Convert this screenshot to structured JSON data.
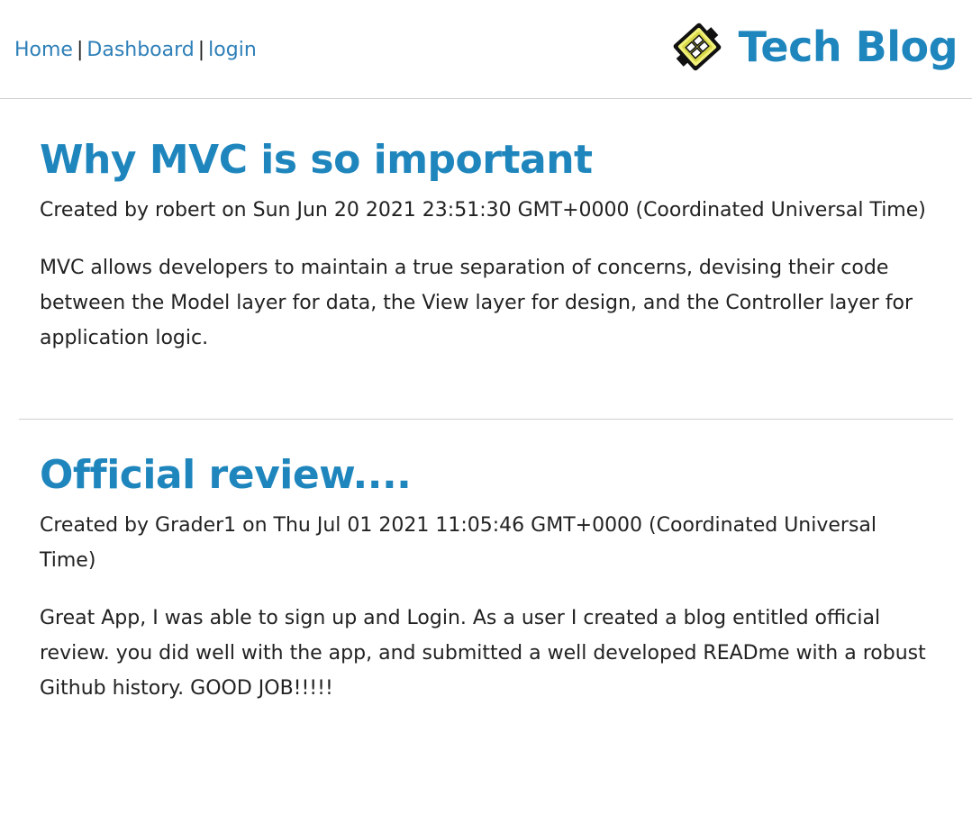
{
  "nav": {
    "home": "Home",
    "dashboard": "Dashboard",
    "login": "login",
    "separator": "|"
  },
  "brand": {
    "title": "Tech Blog",
    "logo_icon": "tech-blog-logo-icon",
    "accent_color": "#1f86bd"
  },
  "posts": [
    {
      "title": "Why MVC is so important",
      "meta": "Created by robert on Sun Jun 20 2021 23:51:30 GMT+0000 (Coordinated Universal Time)",
      "body": "MVC allows developers to maintain a true separation of concerns, devising their code between the Model layer for data, the View layer for design, and the Controller layer for application logic."
    },
    {
      "title": "Official review....",
      "meta": "Created by Grader1 on Thu Jul 01 2021 11:05:46 GMT+0000 (Coordinated Universal Time)",
      "body": "Great App, I was able to sign up and Login. As a user I created a blog entitled official review. you did well with the app, and submitted a well developed READme with a robust Github history. GOOD JOB!!!!!"
    }
  ]
}
